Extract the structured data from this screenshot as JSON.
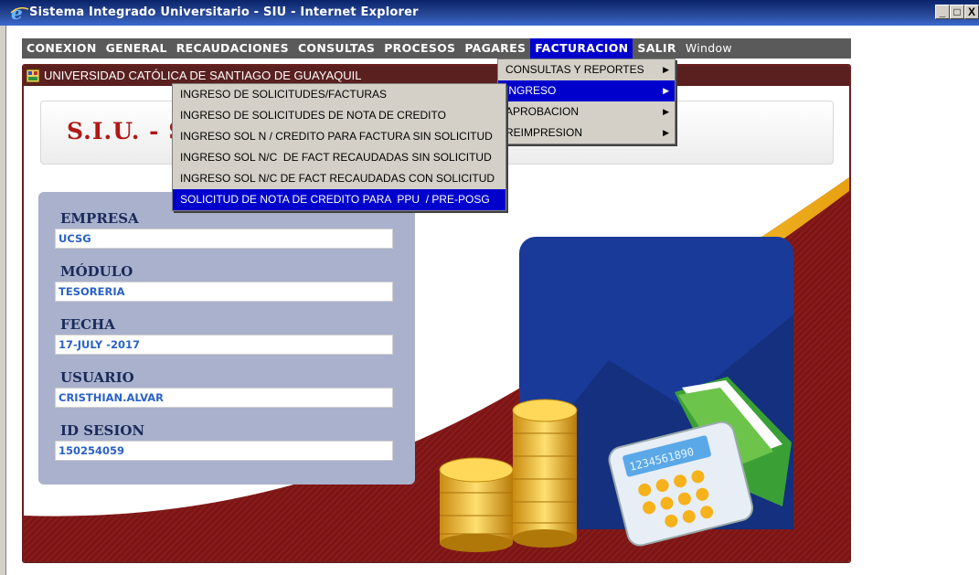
{
  "window": {
    "title": "Sistema Integrado Universitario - SIU - Internet Explorer",
    "buttons": [
      "_",
      "□",
      "X"
    ]
  },
  "menubar": {
    "items": [
      {
        "label": "CONEXION",
        "active": false
      },
      {
        "label": "GENERAL",
        "active": false
      },
      {
        "label": "RECAUDACIONES",
        "active": false
      },
      {
        "label": "CONSULTAS",
        "active": false
      },
      {
        "label": "PROCESOS",
        "active": false
      },
      {
        "label": "PAGARES",
        "active": false
      },
      {
        "label": "FACTURACION",
        "active": true
      },
      {
        "label": "SALIR",
        "active": false
      },
      {
        "label": "Window",
        "active": false
      }
    ]
  },
  "app": {
    "title": "UNIVERSIDAD CATÓLICA DE SANTIAGO DE GUAYAQUIL",
    "brand": "S.I.U. - S",
    "fields": [
      {
        "label": "EMPRESA",
        "value": "UCSG"
      },
      {
        "label": "MÓDULO",
        "value": "TESORERIA"
      },
      {
        "label": "FECHA",
        "value": "17-JULY -2017"
      },
      {
        "label": "USUARIO",
        "value": "CRISTHIAN.ALVAR"
      },
      {
        "label": "ID SESION",
        "value": "150254059"
      }
    ],
    "calculator_display": "1234561890"
  },
  "facturacion_menu": {
    "items": [
      {
        "label": "CONSULTAS Y REPORTES",
        "highlighted": false
      },
      {
        "label": "INGRESO",
        "highlighted": true
      },
      {
        "label": "APROBACION",
        "highlighted": false
      },
      {
        "label": "REIMPRESION",
        "highlighted": false
      }
    ]
  },
  "ingreso_menu": {
    "items": [
      {
        "label": "INGRESO DE SOLICITUDES/FACTURAS",
        "highlighted": false
      },
      {
        "label": "INGRESO DE SOLICITUDES DE NOTA DE CREDITO",
        "highlighted": false
      },
      {
        "label": "INGRESO SOL N / CREDITO PARA FACTURA SIN SOLICITUD",
        "highlighted": false
      },
      {
        "label": "INGRESO SOL N/C  DE FACT RECAUDADAS SIN SOLICITUD",
        "highlighted": false
      },
      {
        "label": "INGRESO SOL N/C DE FACT RECAUDADAS CON SOLICITUD",
        "highlighted": false
      },
      {
        "label": "SOLICITUD DE NOTA DE CREDITO PARA  PPU  / PRE-POSG",
        "highlighted": true
      }
    ]
  },
  "colors": {
    "menu_highlight": "#0000cc",
    "brand_red": "#b01818",
    "frame_maroon": "#6b1f1f",
    "accent_yellow": "#f3b81a",
    "panel_blue": "#a9b1cc"
  }
}
